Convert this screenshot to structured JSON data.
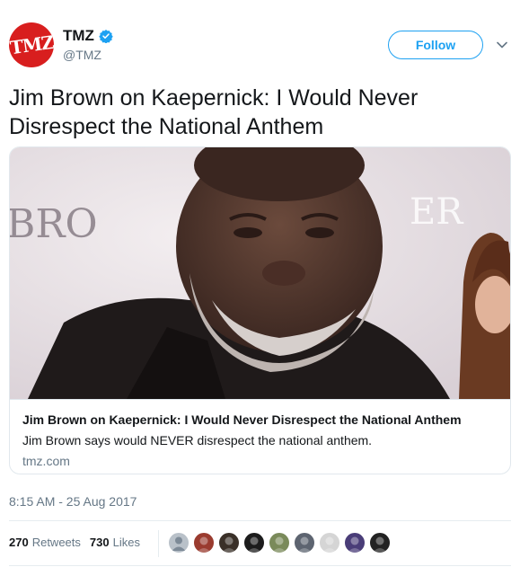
{
  "account": {
    "avatar_text": "TMZ",
    "display_name": "TMZ",
    "handle": "@TMZ",
    "verified": true,
    "avatar_color": "#d81e1e"
  },
  "follow_label": "Follow",
  "tweet_text": "Jim Brown on Kaepernick: I Would Never Disrespect the National Anthem",
  "card": {
    "title": "Jim Brown on Kaepernick: I Would Never Disrespect the National Anthem",
    "description": "Jim Brown says would NEVER disrespect the national anthem.",
    "domain": "tmz.com",
    "image_backdrop_text": "BRO"
  },
  "timestamp": "8:15 AM - 25 Aug 2017",
  "stats": {
    "retweets_count": "270",
    "retweets_label": "Retweets",
    "likes_count": "730",
    "likes_label": "Likes"
  },
  "likers": [
    {
      "color": "#b9c1c9"
    },
    {
      "color": "#9a3b2f"
    },
    {
      "color": "#3a3028"
    },
    {
      "color": "#1c1c1c"
    },
    {
      "color": "#7a8a5a"
    },
    {
      "color": "#5d6470"
    },
    {
      "color": "#d5d5d5"
    },
    {
      "color": "#4a3d78"
    },
    {
      "color": "#222222"
    }
  ],
  "colors": {
    "accent": "#1da1f2",
    "secondary_text": "#657786",
    "border": "#e1e8ed"
  }
}
